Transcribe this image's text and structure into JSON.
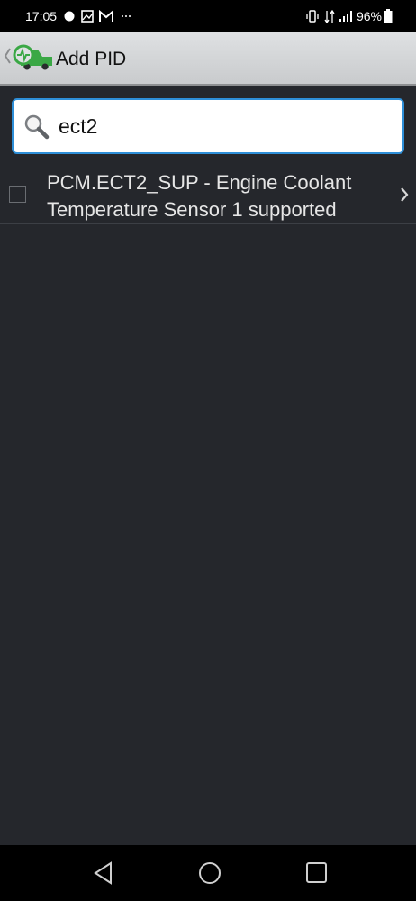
{
  "status_bar": {
    "time": "17:05",
    "battery": "96%",
    "icons": [
      "signal-dot-icon",
      "gallery-icon",
      "gmail-icon",
      "more-icon",
      "vibrate-icon",
      "data-icon",
      "cell-signal-icon",
      "battery-icon"
    ]
  },
  "app_bar": {
    "title": "Add PID",
    "logo_color": "#3aa845"
  },
  "search": {
    "value": "ect2",
    "accent": "#2e8fd8"
  },
  "results": [
    {
      "label": "PCM.ECT2_SUP - Engine Coolant Temperature Sensor 1 supported",
      "checked": false
    }
  ],
  "nav_bar": {
    "buttons": [
      "back-icon",
      "home-icon",
      "recents-icon"
    ]
  }
}
